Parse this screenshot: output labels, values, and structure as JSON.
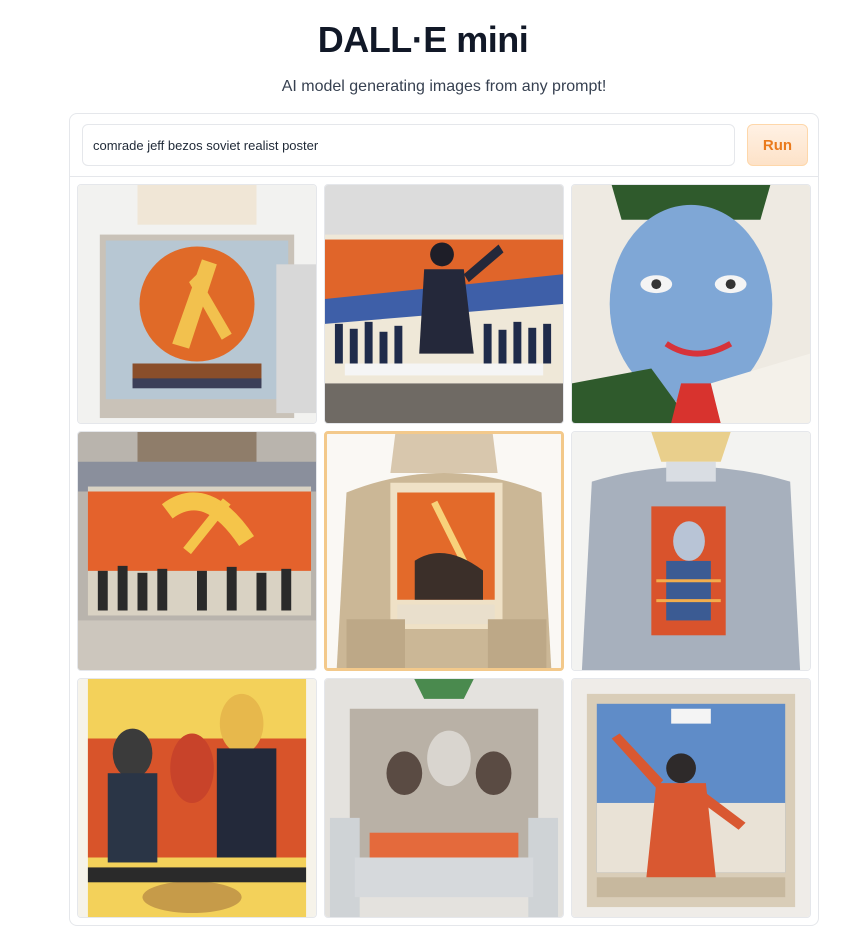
{
  "header": {
    "title": "DALL·E mini",
    "subtitle": "AI model generating images from any prompt!"
  },
  "prompt": {
    "value": "comrade jeff bezos soviet realist poster",
    "run_label": "Run"
  },
  "results": {
    "selected_index": 4,
    "images": [
      {
        "name": "generated-image-1"
      },
      {
        "name": "generated-image-2"
      },
      {
        "name": "generated-image-3"
      },
      {
        "name": "generated-image-4"
      },
      {
        "name": "generated-image-5"
      },
      {
        "name": "generated-image-6"
      },
      {
        "name": "generated-image-7"
      },
      {
        "name": "generated-image-8"
      },
      {
        "name": "generated-image-9"
      }
    ]
  },
  "colors": {
    "accent": "#ea7a1c",
    "run_bg": "#fde2c8",
    "selected_border": "#f3c98b",
    "border": "#e5e7eb"
  }
}
